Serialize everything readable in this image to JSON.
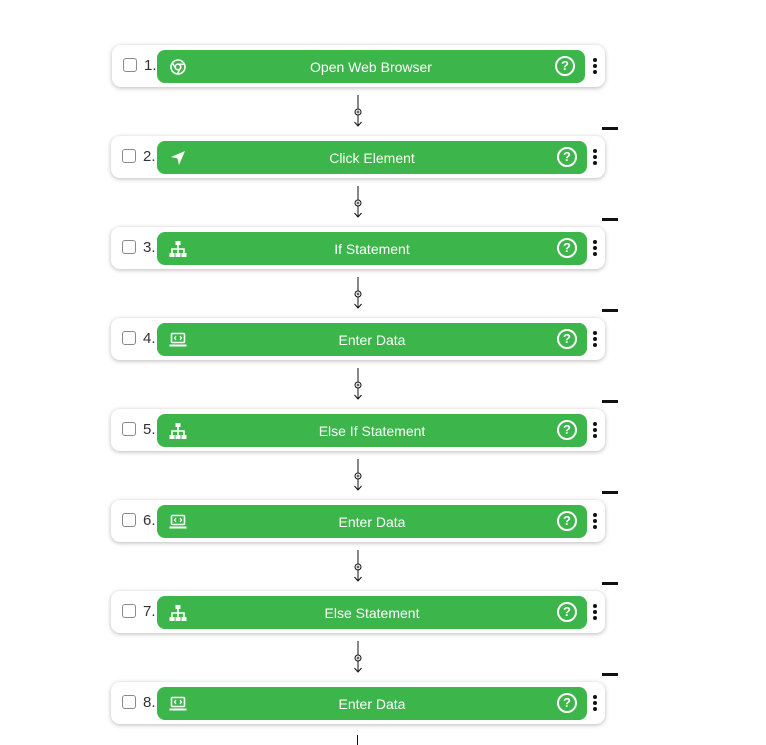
{
  "colors": {
    "step_green": "#3cb54a",
    "card_bg": "#ffffff",
    "text_dark": "#333333"
  },
  "steps": [
    {
      "number": "1.",
      "label": "Open Web Browser",
      "icon": "chrome-icon"
    },
    {
      "number": "2.",
      "label": "Click Element",
      "icon": "cursor-arrow-icon"
    },
    {
      "number": "3.",
      "label": "If Statement",
      "icon": "hierarchy-icon"
    },
    {
      "number": "4.",
      "label": "Enter Data",
      "icon": "laptop-code-icon"
    },
    {
      "number": "5.",
      "label": "Else If Statement",
      "icon": "hierarchy-icon"
    },
    {
      "number": "6.",
      "label": "Enter Data",
      "icon": "laptop-code-icon"
    },
    {
      "number": "7.",
      "label": "Else Statement",
      "icon": "hierarchy-icon"
    },
    {
      "number": "8.",
      "label": "Enter Data",
      "icon": "laptop-code-icon"
    }
  ]
}
